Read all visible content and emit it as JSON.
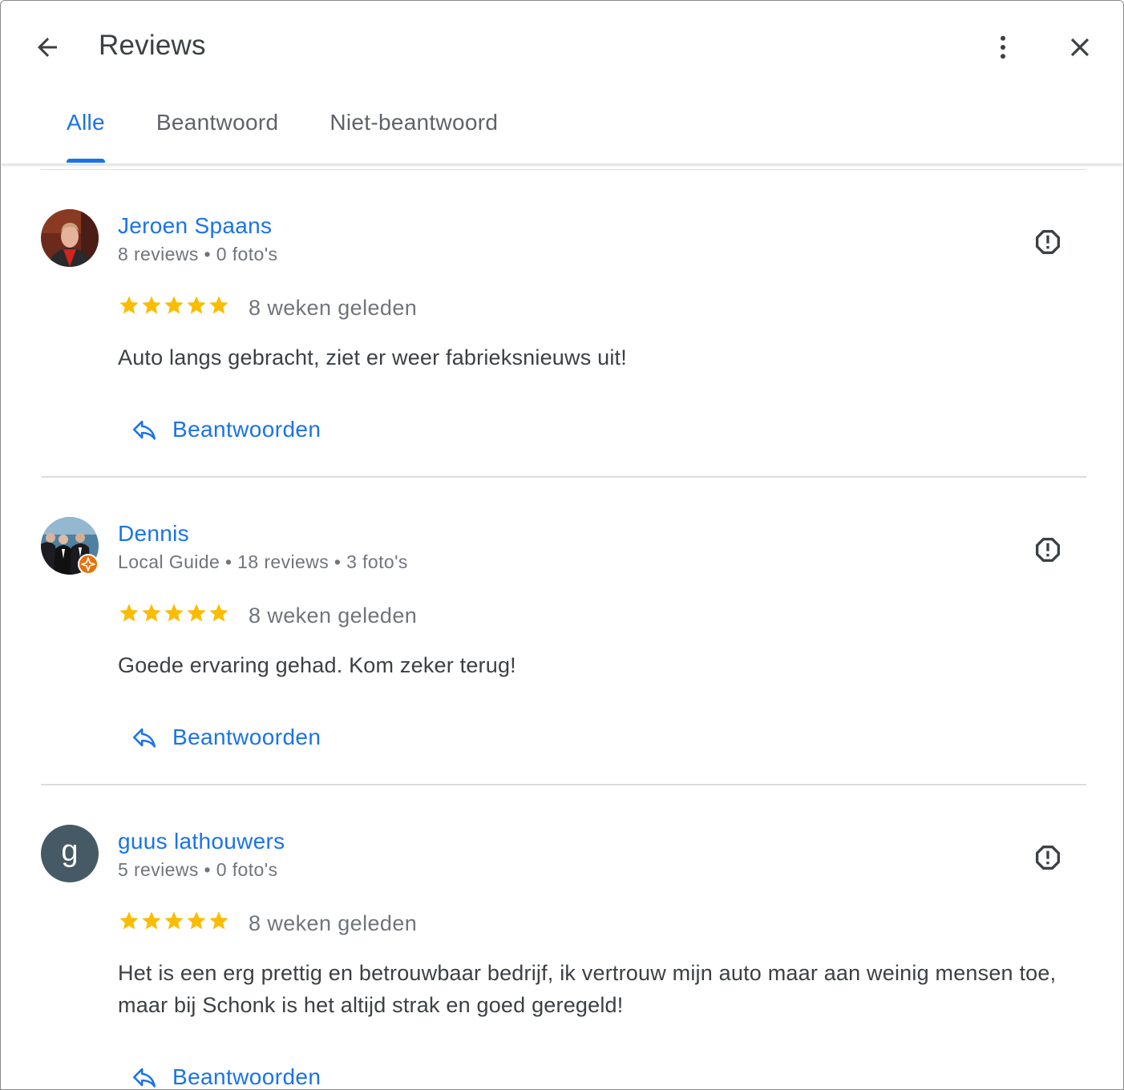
{
  "header": {
    "title": "Reviews",
    "back_icon": "arrow-back-icon",
    "more_icon": "more-vert-icon",
    "close_icon": "close-icon"
  },
  "tabs": [
    {
      "label": "Alle",
      "active": true
    },
    {
      "label": "Beantwoord",
      "active": false
    },
    {
      "label": "Niet-beantwoord",
      "active": false
    }
  ],
  "colors": {
    "accent": "#1a73e8",
    "star": "#fbbc04",
    "muted": "#70757a",
    "local_guide_badge": "#e8710a"
  },
  "reviews": [
    {
      "name": "Jeroen Spaans",
      "meta": "8 reviews • 0 foto's",
      "avatar": "photo",
      "rating": 5,
      "date": "8 weken geleden",
      "text": "Auto langs gebracht, ziet er weer fabrieksnieuws uit!",
      "reply_label": "Beantwoorden"
    },
    {
      "name": "Dennis",
      "meta": "Local Guide • 18 reviews • 3 foto's",
      "avatar": "photo",
      "local_guide": true,
      "rating": 5,
      "date": "8 weken geleden",
      "text": "Goede ervaring gehad. Kom zeker terug!",
      "reply_label": "Beantwoorden"
    },
    {
      "name": "guus lathouwers",
      "meta": "5 reviews • 0 foto's",
      "avatar_letter": "g",
      "rating": 5,
      "date": "8 weken geleden",
      "text": "Het is een erg prettig en betrouwbaar bedrijf, ik vertrouw mijn auto maar aan weinig mensen toe, maar bij Schonk is het altijd strak en goed geregeld!",
      "reply_label": "Beantwoorden"
    }
  ]
}
